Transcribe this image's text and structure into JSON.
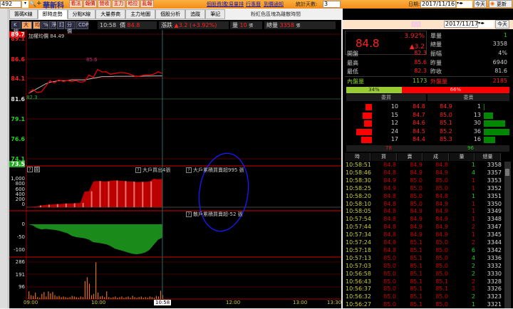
{
  "topbar": {
    "code": "492",
    "stock_name": "華新科",
    "buttons": [
      "看法",
      "報價",
      "營收",
      "主力",
      "哈拉",
      "亂報"
    ],
    "links": [
      "個股資訊",
      "交易量排",
      "行事曆",
      "到價通知"
    ],
    "stat_days_label": "統計天數:",
    "stat_days": "3",
    "date_label": "日期:",
    "date": "2017/11/16",
    "today": "今天",
    "refresh": "更新"
  },
  "tabs": [
    "籌碼K線",
    "即時走勢",
    "分點K線",
    "大量券商",
    "主力地圖",
    "個股分析",
    "追蹤",
    "筆記"
  ],
  "note": "粉紅色區塊為離散時間",
  "toolbar": {
    "buttons": [
      "K線",
      "大戶",
      "均",
      "%",
      "淨",
      "訂",
      "分價",
      "CDP"
    ],
    "time": "10:58",
    "price_label": "價",
    "price": "84.8",
    "change_label": "漲跌",
    "change": "▲3.2 (+3.92%)",
    "vol_label": "量",
    "vol": "10",
    "unit": "張",
    "total_label": "總量",
    "total": "3358"
  },
  "price_panel": {
    "avg_label": "加權均價 84.49",
    "high_mark": "85.6",
    "open_mark": "82.3",
    "axis": [
      "89.7",
      "89.1",
      "86.6",
      "84.1",
      "81.6",
      "79.1",
      "76.6",
      "74.1",
      "73.5"
    ],
    "price_series": [
      82.3,
      82.8,
      82.4,
      82.5,
      83.2,
      83.9,
      83.6,
      84.0,
      83.8,
      83.9,
      83.8,
      83.9,
      83.7,
      83.8,
      84.6,
      84.3,
      85.3,
      85.0,
      85.0,
      84.7,
      84.8,
      84.9,
      84.9,
      84.8,
      84.6,
      84.4,
      84.5,
      84.6,
      84.6,
      84.7,
      85.0,
      84.8
    ],
    "avg_series": [
      82.3,
      82.6,
      82.9,
      83.2,
      83.5,
      83.7,
      83.8,
      83.9,
      83.9,
      83.9,
      84.0,
      84.0,
      84.0,
      84.0,
      84.1,
      84.2,
      84.3,
      84.4,
      84.4,
      84.4,
      84.45,
      84.45,
      84.45,
      84.45,
      84.45,
      84.45,
      84.45,
      84.47,
      84.47,
      84.48,
      84.49,
      84.49
    ]
  },
  "big_panel": {
    "q": "?",
    "set": "設",
    "buy_label": "大戶買出4張",
    "acc_label": "大戶累積買賣超995 張",
    "axis": [
      "1,000",
      "800",
      "600",
      "400",
      "200",
      "0"
    ],
    "series": [
      10,
      20,
      30,
      60,
      80,
      90,
      100,
      110,
      120,
      130,
      130,
      140,
      150,
      550,
      560,
      900,
      920,
      910,
      900,
      930,
      940,
      930,
      920,
      900,
      900,
      880,
      890,
      890,
      900,
      1000,
      980,
      995
    ]
  },
  "retail_panel": {
    "acc_label": "散戶累積買賣超-52 張",
    "axis": [
      "0",
      "-50",
      "-100"
    ],
    "series": [
      0,
      -5,
      -15,
      -20,
      -18,
      -20,
      -22,
      -25,
      -30,
      -35,
      -45,
      -50,
      -52,
      -55,
      -60,
      -70,
      -72,
      -75,
      -78,
      -85,
      -95,
      -100,
      -105,
      -110,
      -115,
      -117,
      -115,
      -110,
      -100,
      -80,
      -60,
      -52
    ]
  },
  "volume_panel": {
    "axis": [
      "286",
      "191",
      "96"
    ],
    "series": [
      60,
      30,
      25,
      50,
      15,
      10,
      40,
      55,
      20,
      60,
      45,
      55,
      30,
      20,
      25,
      15,
      20,
      15,
      10,
      15,
      25,
      20,
      15,
      10,
      20,
      15,
      140,
      170,
      120,
      30,
      40,
      286,
      50,
      20,
      25,
      15,
      60,
      15,
      10,
      15,
      20,
      10,
      15,
      20,
      10,
      15,
      20,
      10,
      25,
      15,
      10,
      15,
      20,
      10,
      15,
      10,
      20,
      15,
      10,
      25,
      20,
      65,
      30
    ]
  },
  "time_axis": [
    "09:00",
    "10:00",
    "10:58",
    "12:00",
    "13:00",
    "13:30"
  ],
  "right": {
    "date": "2017/11/17",
    "today": "今天",
    "price": "84.8",
    "pct": "3.92%",
    "chg": "▲3.2",
    "single_label": "單量",
    "single": "1",
    "total_label": "總量",
    "total": "3358",
    "stats": [
      [
        "開盤",
        "82.3",
        "振幅",
        "4%"
      ],
      [
        "最高",
        "85.6",
        "昨量",
        "6940"
      ],
      [
        "最低",
        "82.3",
        "昨收",
        "81.6"
      ]
    ],
    "inner_label": "內盤量",
    "inner": "1173",
    "outer_label": "外盤量",
    "outer": "2185",
    "inner_pct": "34%",
    "outer_pct": "66%",
    "bid_label": "委買",
    "ask_label": "委賣",
    "book": [
      [
        "10",
        "84.8",
        "84.9",
        "1"
      ],
      [
        "15",
        "84.7",
        "85.0",
        "13"
      ],
      [
        "12",
        "84.6",
        "85.1",
        "30"
      ],
      [
        "24",
        "84.5",
        "85.2",
        "36"
      ],
      [
        "17",
        "84.4",
        "85.3",
        "16"
      ]
    ],
    "bid_total": "78",
    "ask_total": "96",
    "cols": [
      "時",
      "買",
      "賣",
      "成",
      "量",
      "總量"
    ],
    "ticks": [
      [
        "10:58:51",
        "84.8",
        "84.9",
        "84.8",
        "1",
        "3358",
        "g"
      ],
      [
        "10:58:46",
        "84.8",
        "84.9",
        "84.9",
        "4",
        "3357",
        "g"
      ],
      [
        "10:58:30",
        "84.9",
        "85.0",
        "85.0",
        "1",
        "3353",
        "r"
      ],
      [
        "10:58:25",
        "84.9",
        "85.0",
        "85.0",
        "1",
        "3352",
        "r"
      ],
      [
        "10:58:20",
        "84.8",
        "85.0",
        "84.8",
        "1",
        "3351",
        "g"
      ],
      [
        "10:58:10",
        "84.8",
        "85.0",
        "84.9",
        "1",
        "3350",
        "r"
      ],
      [
        "10:58:05",
        "84.8",
        "84.9",
        "84.9",
        "1",
        "3349",
        "r"
      ],
      [
        "10:57:54",
        "84.8",
        "84.9",
        "84.9",
        "1",
        "3348",
        "r"
      ],
      [
        "10:57:44",
        "84.8",
        "84.9",
        "84.9",
        "2",
        "3347",
        "r"
      ],
      [
        "10:57:34",
        "84.8",
        "84.9",
        "84.9",
        "1",
        "3345",
        "r"
      ],
      [
        "10:57:24",
        "84.8",
        "85.1",
        "85.0",
        "2",
        "3344",
        "r"
      ],
      [
        "10:57:18",
        "84.8",
        "85.1",
        "85.0",
        "6",
        "3342",
        "g"
      ],
      [
        "10:57:13",
        "85.0",
        "85.1",
        "85.0",
        "4",
        "3336",
        "g"
      ],
      [
        "10:57:03",
        "85.0",
        "85.1",
        "85.0",
        "2",
        "3332",
        "g"
      ],
      [
        "10:56:58",
        "85.0",
        "85.1",
        "85.0",
        "2",
        "3330",
        "g"
      ],
      [
        "10:56:43",
        "85.0",
        "85.1",
        "85.1",
        "2",
        "3328",
        "r"
      ],
      [
        "10:56:37",
        "85.0",
        "85.1",
        "85.1",
        "3",
        "3326",
        "r"
      ],
      [
        "10:56:32",
        "85.0",
        "85.1",
        "85.0",
        "2",
        "3323",
        "g"
      ],
      [
        "10:56:27",
        "85.0",
        "85.1",
        "85.0",
        "1",
        "3321",
        "g"
      ]
    ]
  }
}
